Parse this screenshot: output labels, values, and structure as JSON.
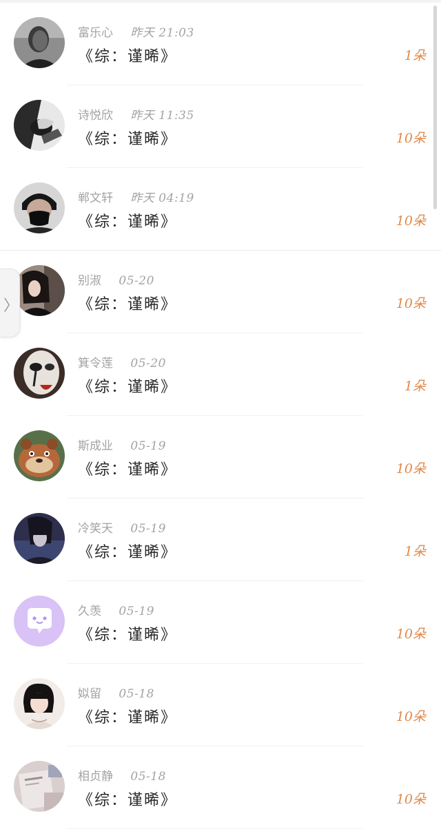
{
  "scrollbar_position_fraction": 0,
  "records": [
    {
      "name": "富乐心",
      "time": "昨天 21:03",
      "title": "《综：谨晞》",
      "amount": "1朵",
      "avatar": "avatar-man-grayscale-portrait"
    },
    {
      "name": "诗悦欣",
      "time": "昨天 11:35",
      "title": "《综：谨晞》",
      "amount": "10朵",
      "avatar": "avatar-man-black-white-hands"
    },
    {
      "name": "郸文轩",
      "time": "昨天 04:19",
      "title": "《综：谨晞》",
      "amount": "10朵",
      "avatar": "avatar-man-black-mask"
    },
    {
      "name": "别淑",
      "time": "05-20",
      "title": "《综：谨晞》",
      "amount": "10朵",
      "avatar": "avatar-girl-dark-hair"
    },
    {
      "name": "箕令莲",
      "time": "05-20",
      "title": "《综：谨晞》",
      "amount": "1朵",
      "avatar": "avatar-clown-face"
    },
    {
      "name": "斯成业",
      "time": "05-19",
      "title": "《综：谨晞》",
      "amount": "10朵",
      "avatar": "avatar-cartoon-bear"
    },
    {
      "name": "冷笑天",
      "time": "05-19",
      "title": "《综：谨晞》",
      "amount": "1朵",
      "avatar": "avatar-anime-dark-hair"
    },
    {
      "name": "久羡",
      "time": "05-19",
      "title": "《综：谨晞》",
      "amount": "10朵",
      "avatar": "avatar-purple-chat-bubble"
    },
    {
      "name": "姒留",
      "time": "05-18",
      "title": "《综：谨晞》",
      "amount": "10朵",
      "avatar": "avatar-girl-bob-hair"
    },
    {
      "name": "相贞静",
      "time": "05-18",
      "title": "《综：谨晞》",
      "amount": "10朵",
      "avatar": "avatar-book-photo"
    }
  ],
  "colors": {
    "amount": "#e0894a",
    "meta": "#a3a3a3",
    "title": "#2a2a2a",
    "chat_avatar_bg": "#d8c2f6"
  }
}
